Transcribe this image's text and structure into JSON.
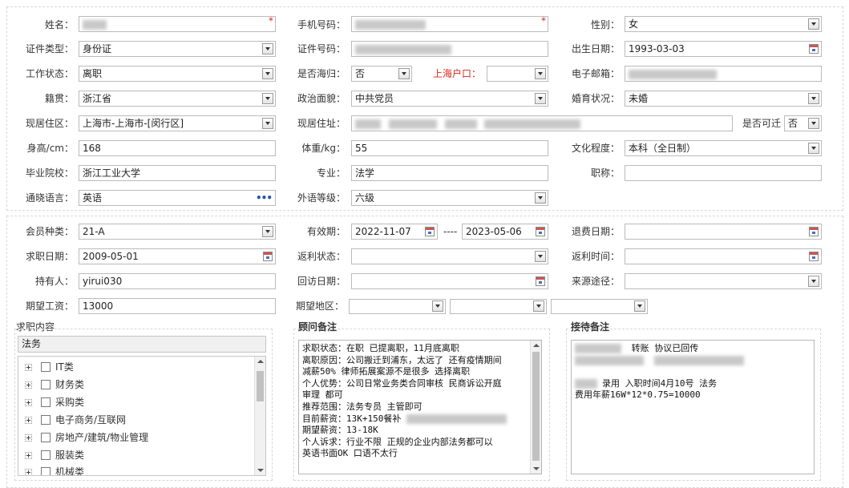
{
  "basic": {
    "name": {
      "label": "姓名：",
      "value": ""
    },
    "phone": {
      "label": "手机号码：",
      "value": ""
    },
    "gender": {
      "label": "性别：",
      "value": "女"
    },
    "id_type": {
      "label": "证件类型：",
      "value": "身份证"
    },
    "id_number": {
      "label": "证件号码：",
      "value": ""
    },
    "birth_date": {
      "label": "出生日期：",
      "value": "1993-03-03"
    },
    "work_status": {
      "label": "工作状态：",
      "value": "离职"
    },
    "returnee": {
      "label": "是否海归：",
      "value": "否"
    },
    "shanghai_hukou": {
      "label": "上海户口：",
      "value": ""
    },
    "email": {
      "label": "电子邮箱：",
      "value": ""
    },
    "native_place": {
      "label": "籍贯：",
      "value": "浙江省"
    },
    "political": {
      "label": "政治面貌：",
      "value": "中共党员"
    },
    "marital": {
      "label": "婚育状况：",
      "value": "未婚"
    },
    "residence_area": {
      "label": "现居住区：",
      "value": "上海市-上海市-[闵行区]"
    },
    "address": {
      "label": "现居住址：",
      "value": ""
    },
    "relocate": {
      "label": "是否可迁",
      "value": "否"
    },
    "height": {
      "label": "身高/cm：",
      "value": "168"
    },
    "weight": {
      "label": "体重/kg：",
      "value": "55"
    },
    "education": {
      "label": "文化程度：",
      "value": "本科（全日制）"
    },
    "school": {
      "label": "毕业院校：",
      "value": "浙江工业大学"
    },
    "major": {
      "label": "专业：",
      "value": "法学"
    },
    "title": {
      "label": "职称：",
      "value": ""
    },
    "language": {
      "label": "通晓语言：",
      "value": "英语"
    },
    "lang_level": {
      "label": "外语等级：",
      "value": "六级"
    }
  },
  "member": {
    "type": {
      "label": "会员种类：",
      "value": "21-A"
    },
    "valid": {
      "label": "有效期：",
      "from": "2022-11-07",
      "sep": "----",
      "to": "2023-05-06"
    },
    "refund_date": {
      "label": "退费日期：",
      "value": ""
    },
    "job_date": {
      "label": "求职日期：",
      "value": "2009-05-01"
    },
    "rebate_status": {
      "label": "返利状态：",
      "value": ""
    },
    "rebate_time": {
      "label": "返利时间：",
      "value": ""
    },
    "holder": {
      "label": "持有人：",
      "value": "yirui030"
    },
    "revisit_date": {
      "label": "回访日期：",
      "value": ""
    },
    "source": {
      "label": "来源途径：",
      "value": ""
    },
    "salary": {
      "label": "期望工资：",
      "value": "13000"
    },
    "region": {
      "label": "期望地区：",
      "v1": "",
      "v2": "",
      "v3": ""
    }
  },
  "job_content": {
    "title": "求职内容",
    "selected": "法务",
    "items": [
      "IT类",
      "财务类",
      "采购类",
      "电子商务/互联网",
      "房地产/建筑/物业管理",
      "服装类",
      "机械类"
    ]
  },
  "advisor_notes": {
    "title": "顾问备注",
    "lines": [
      "求职状态：在职 已提离职，11月底离职",
      "离职原因：公司搬迁到浦东，太远了 还有疫情期间",
      "减薪50% 律师拓展案源不是很多 选择离职",
      "个人优势：公司日常业务类合同审核  民商诉讼开庭",
      "审理 都可",
      "推荐范围：法务专员 主管即可",
      "目前薪资：13K+150餐补",
      "期望薪资：13-18K",
      "个人诉求：行业不限  正规的企业内部法务都可以",
      "英语书面OK  口语不太行"
    ]
  },
  "reception_notes": {
    "title": "接待备注",
    "line1": "转账 协议已回传",
    "line2": "录用  入职时间4月10号  法务",
    "line3": "费用年薪16W*12*0.75=10000"
  }
}
